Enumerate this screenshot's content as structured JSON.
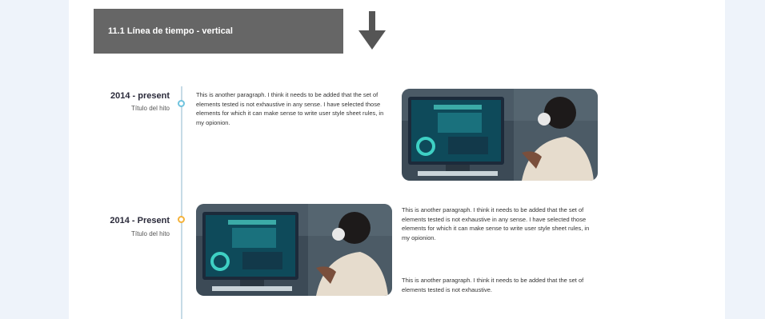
{
  "header": {
    "title": "11.1 Línea de tiempo - vertical",
    "arrow_icon": "arrow-down-icon"
  },
  "timeline": {
    "items": [
      {
        "year": "2014 - present",
        "subtitle": "Título del hito",
        "paragraphs": [
          "This is another paragraph. I think it needs to be added that the set of elements tested is not exhaustive in any sense. I have selected those elements for which it can make sense to write user style sheet rules, in my opionion."
        ],
        "image_icon": "workstation-photo"
      },
      {
        "year": "2014 - Present",
        "subtitle": "Título del hito",
        "paragraphs": [
          "This is another paragraph. I think it needs to be added that the set of elements tested is not exhaustive in any sense. I have selected those elements for which it can make sense to write user style sheet rules, in my opionion.",
          "This is another paragraph. I think it needs to be added that the set of elements tested is not exhaustive."
        ],
        "image_icon": "workstation-photo"
      }
    ]
  },
  "colors": {
    "header_bg": "#666666",
    "line": "#c6dbe6",
    "dot_1": "#6fc3de",
    "dot_2": "#f4b23a"
  }
}
